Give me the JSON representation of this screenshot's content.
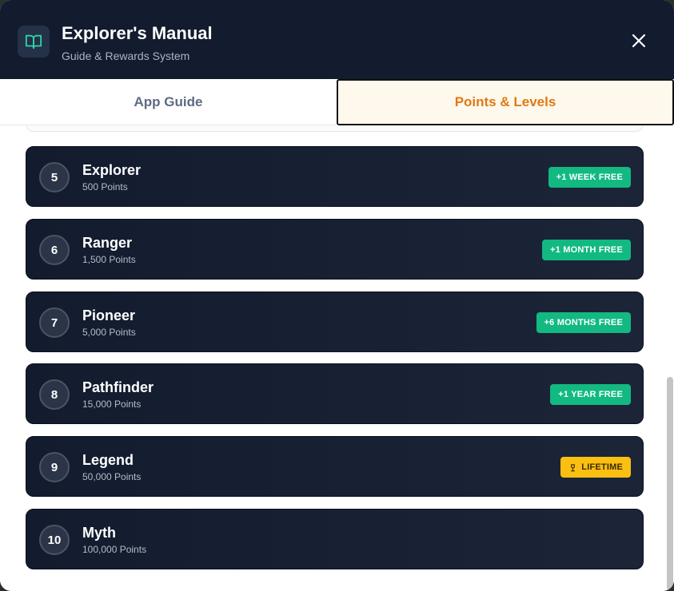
{
  "header": {
    "title": "Explorer's Manual",
    "subtitle": "Guide & Rewards System",
    "logo_icon": "book-open-icon",
    "close_icon": "close-icon"
  },
  "tabs": [
    {
      "label": "App Guide",
      "active": false
    },
    {
      "label": "Points & Levels",
      "active": true
    }
  ],
  "levels": [
    {
      "number": "5",
      "name": "Explorer",
      "points": "500 Points",
      "reward": "+1 WEEK FREE",
      "reward_type": "green"
    },
    {
      "number": "6",
      "name": "Ranger",
      "points": "1,500 Points",
      "reward": "+1 MONTH FREE",
      "reward_type": "green"
    },
    {
      "number": "7",
      "name": "Pioneer",
      "points": "5,000 Points",
      "reward": "+6 MONTHS FREE",
      "reward_type": "green"
    },
    {
      "number": "8",
      "name": "Pathfinder",
      "points": "15,000 Points",
      "reward": "+1 YEAR FREE",
      "reward_type": "green"
    },
    {
      "number": "9",
      "name": "Legend",
      "points": "50,000 Points",
      "reward": "LIFETIME",
      "reward_type": "gold",
      "reward_icon": "trophy-icon"
    },
    {
      "number": "10",
      "name": "Myth",
      "points": "100,000 Points",
      "reward": null,
      "reward_type": null
    }
  ],
  "colors": {
    "header_bg": "#131b2e",
    "active_tab_text": "#e07912",
    "reward_green": "#12b981",
    "reward_gold": "#fbbf12"
  }
}
